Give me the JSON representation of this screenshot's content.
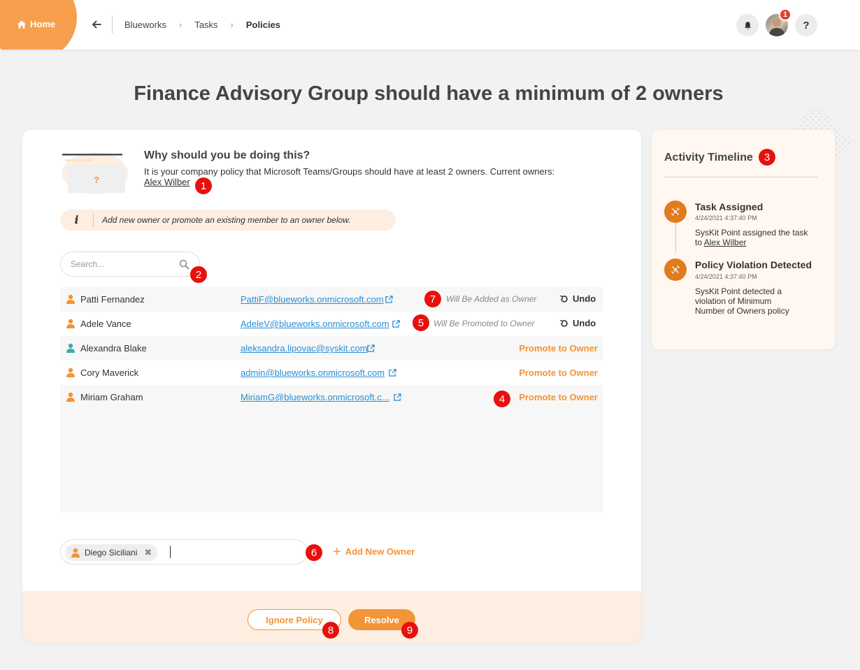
{
  "header": {
    "home_label": "Home",
    "breadcrumbs": [
      "Blueworks",
      "Tasks",
      "Policies"
    ],
    "notification_count": "1",
    "help_label": "?"
  },
  "page": {
    "title": "Finance Advisory Group should have a minimum of 2 owners"
  },
  "why": {
    "title": "Why should you be doing this?",
    "text": "It is your company policy that Microsoft Teams/Groups should have at least 2 owners. Current owners:",
    "owner": "Alex Wilber",
    "illustration_glyph": "?"
  },
  "info": {
    "icon": "i",
    "text": "Add new owner or promote an existing member to an owner below."
  },
  "search": {
    "placeholder": "Search..."
  },
  "members": [
    {
      "name": "Patti Fernandez",
      "email": "PattiF@blueworks.onmicrosoft.com",
      "status": "Will Be Added as Owner",
      "action": "Undo",
      "icon_color": "#f39436"
    },
    {
      "name": "Adele Vance",
      "email": "AdeleV@blueworks.onmicrosoft.com",
      "status": "Will Be Promoted to Owner",
      "action": "Undo",
      "icon_color": "#f39436"
    },
    {
      "name": "Alexandra Blake",
      "email": "aleksandra.lipovac@syskit.com",
      "status": "",
      "action": "Promote to Owner",
      "icon_color": "#3aaea6"
    },
    {
      "name": "Cory Maverick",
      "email": "admin@blueworks.onmicrosoft.com",
      "status": "",
      "action": "Promote to Owner",
      "icon_color": "#f39436"
    },
    {
      "name": "Miriam Graham",
      "email": "MiriamG@blueworks.onmicrosoft.c...",
      "status": "",
      "action": "Promote to Owner",
      "icon_color": "#f39436"
    }
  ],
  "new_owner": {
    "chip_name": "Diego Siciliani",
    "add_label": "Add New Owner"
  },
  "actions": {
    "ignore_label": "Ignore Policy",
    "resolve_label": "Resolve"
  },
  "timeline": {
    "title": "Activity Timeline",
    "events": [
      {
        "title": "Task Assigned",
        "time": "4/24/2021 4:37:40 PM",
        "text": "SysKit Point assigned the task to ",
        "link": "Alex Wilber"
      },
      {
        "title": "Policy Violation Detected",
        "time": "4/24/2021 4:37:40 PM",
        "text": "SysKit Point detected a violation of Minimum Number of Owners policy",
        "link": ""
      }
    ]
  },
  "markers": [
    "1",
    "2",
    "3",
    "4",
    "5",
    "6",
    "7",
    "8",
    "9"
  ],
  "colors": {
    "accent": "#f39436",
    "link": "#2a8fd4",
    "marker": "#e8100e",
    "timeline_icon": "#e07b1e"
  }
}
